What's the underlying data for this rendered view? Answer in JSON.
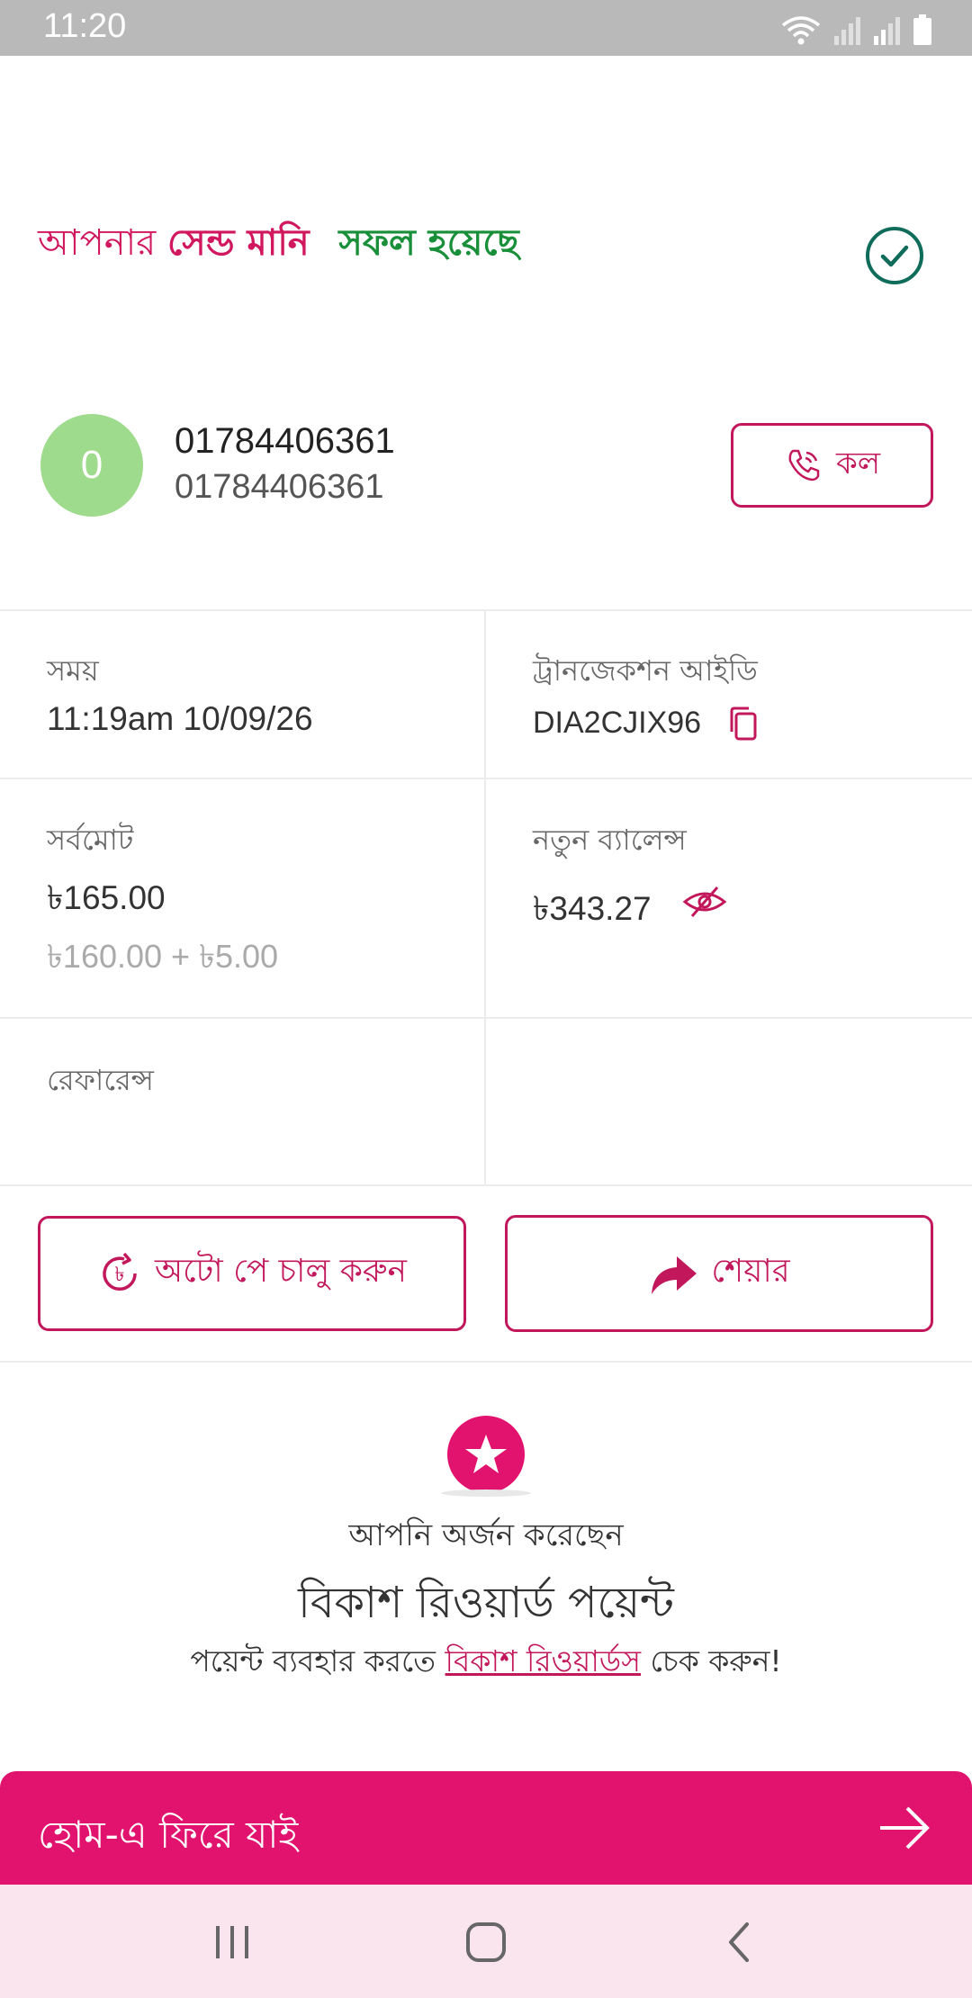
{
  "status_bar": {
    "time": "11:20"
  },
  "header": {
    "prefix": "আপনার",
    "service": "সেন্ড মানি",
    "result": "সফল হয়েছে"
  },
  "contact": {
    "avatar_letter": "0",
    "name": "01784406361",
    "number": "01784406361",
    "call_label": "কল"
  },
  "details": {
    "time_label": "সময়",
    "time_value": "11:19am 10/09/26",
    "trx_label": "ট্রানজেকশন আইডি",
    "trx_value": "DIA2CJIX96",
    "total_label": "সর্বমোট",
    "total_value": "৳165.00",
    "total_breakdown": "৳160.00 + ৳5.00",
    "balance_label": "নতুন ব্যালেন্স",
    "balance_value": "৳343.27",
    "reference_label": "রেফারেন্স"
  },
  "actions": {
    "autopay_label": "অটো পে চালু করুন",
    "share_label": "শেয়ার"
  },
  "reward": {
    "line1": "আপনি অর্জন করেছেন",
    "line2": "বিকাশ রিওয়ার্ড পয়েন্ট",
    "line3_pre": "পয়েন্ট ব্যবহার করতে",
    "line3_link": "বিকাশ রিওয়ার্ডস",
    "line3_post": "চেক করুন!"
  },
  "footer": {
    "home_label": "হোম-এ ফিরে যাই"
  },
  "colors": {
    "brand": "#e2136e",
    "success": "#1a8f3a",
    "outline": "#c2185b"
  }
}
